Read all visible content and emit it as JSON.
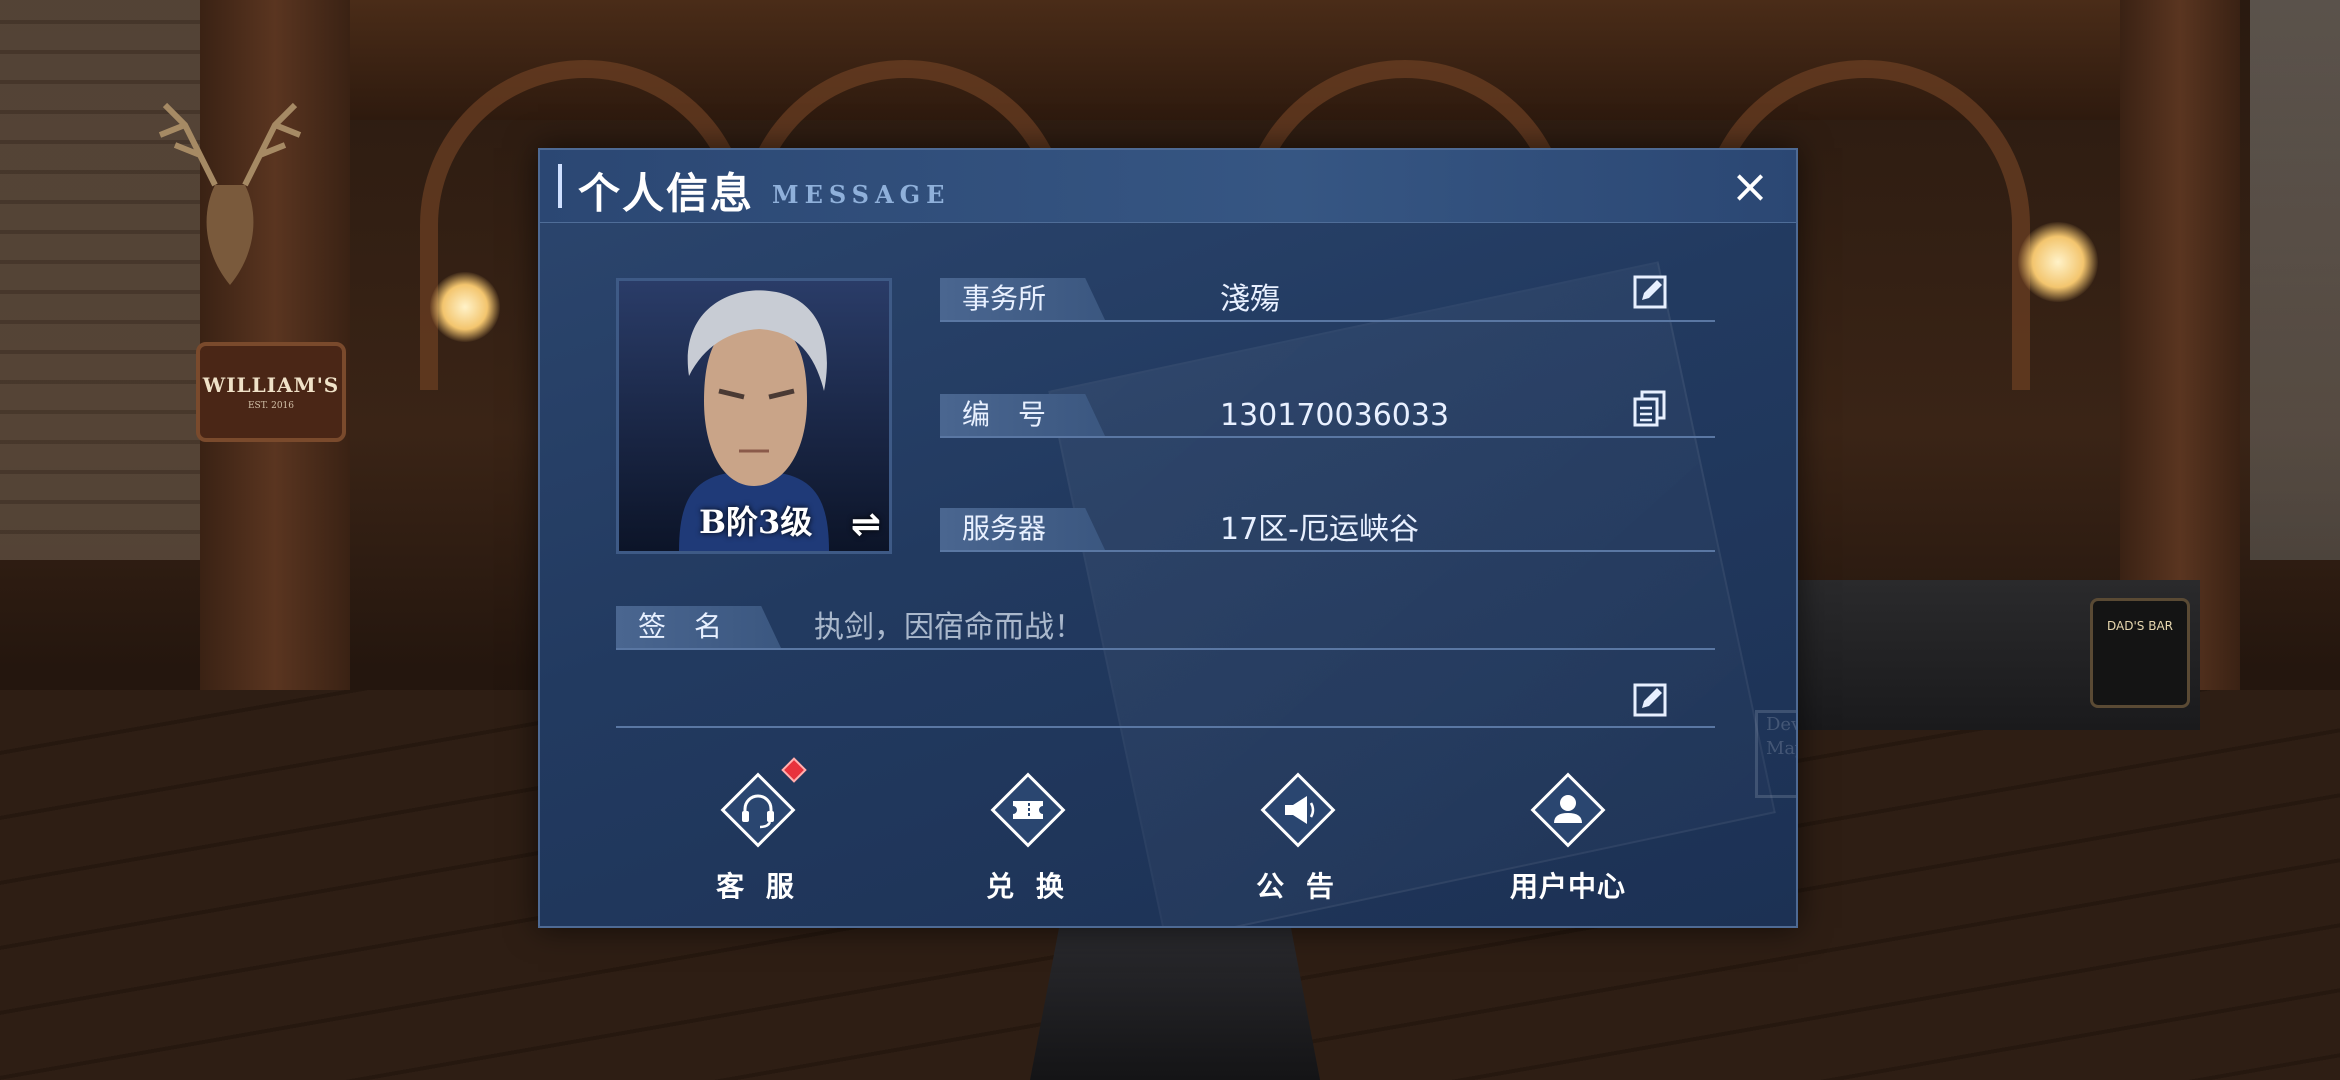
{
  "background": {
    "sign_name": "WILLIAM'S",
    "sign_sub": "EST. 2016",
    "bar_sign": "DAD'S BAR",
    "stamp_text": "Devil May Cry"
  },
  "dialog": {
    "title_cn": "个人信息",
    "title_en": "MESSAGE",
    "close_icon": "×",
    "avatar": {
      "rank": "B阶3级",
      "swap_icon": "⇌"
    },
    "fields": {
      "agency": {
        "label": "事务所",
        "value": "淺殤",
        "icon": "edit-icon"
      },
      "id": {
        "label": "编　号",
        "value": "130170036033",
        "icon": "copy-icon"
      },
      "server": {
        "label": "服务器",
        "value": "17区-厄运峡谷"
      },
      "signature": {
        "label": "签　名",
        "value": "执剑，因宿命而战！",
        "icon": "edit-icon"
      }
    },
    "buttons": [
      {
        "label": "客 服",
        "icon": "headset-icon",
        "has_notification": true
      },
      {
        "label": "兑 换",
        "icon": "ticket-icon"
      },
      {
        "label": "公 告",
        "icon": "megaphone-icon"
      },
      {
        "label": "用户中心",
        "icon": "user-icon"
      }
    ],
    "colors": {
      "accent": "#4a6690",
      "panel": "#223a60",
      "notification": "#e8323c"
    }
  }
}
